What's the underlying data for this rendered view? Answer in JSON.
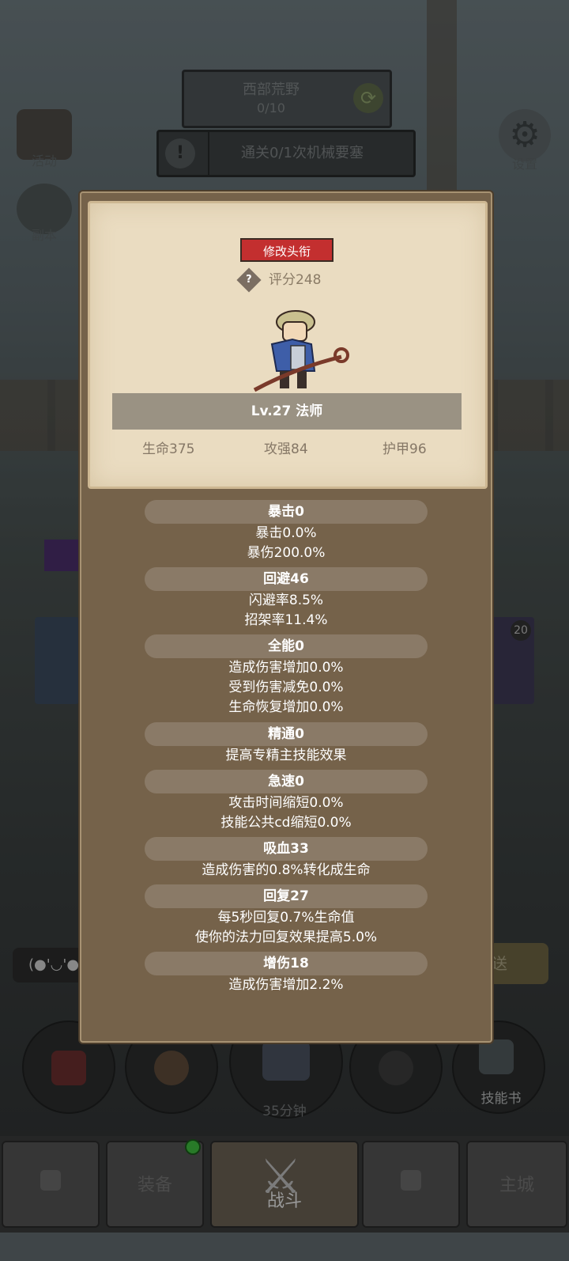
{
  "header": {
    "map_name": "西部荒野",
    "map_progress": "0/10",
    "quest_text": "通关0/1次机械要塞"
  },
  "side": {
    "activity_label": "活动",
    "dungeon_label": "副本",
    "settings_label": "设置"
  },
  "profile": {
    "edit_title_label": "修改头衔",
    "score_label": "评分248",
    "level_class": "Lv.27 法师",
    "hp": "生命375",
    "attack": "攻强84",
    "armor": "护甲96"
  },
  "attributes": [
    {
      "head": "暴击0",
      "lines": [
        "暴击0.0%",
        "暴伤200.0%"
      ]
    },
    {
      "head": "回避46",
      "lines": [
        "闪避率8.5%",
        "招架率11.4%"
      ]
    },
    {
      "head": "全能0",
      "lines": [
        "造成伤害增加0.0%",
        "受到伤害减免0.0%",
        "生命恢复增加0.0%"
      ]
    },
    {
      "head": "精通0",
      "lines": [
        "提高专精主技能效果"
      ]
    },
    {
      "head": "急速0",
      "lines": [
        "攻击时间缩短0.0%",
        "技能公共cd缩短0.0%"
      ]
    },
    {
      "head": "吸血33",
      "lines": [
        "造成伤害的0.8%转化成生命"
      ]
    },
    {
      "head": "回复27",
      "lines": [
        "每5秒回复0.7%生命值",
        "使你的法力回复效果提高5.0%"
      ]
    },
    {
      "head": "增伤18",
      "lines": [
        "造成伤害增加2.2%"
      ]
    }
  ],
  "background_texts": {
    "chat_emote": "(●'◡'●",
    "send_partial": "送",
    "badge_count": "20"
  },
  "bottom": {
    "skill_book_label": "技能书",
    "timer_label": "35分钟"
  },
  "nav": {
    "equip_label": "装备",
    "battle_label": "战斗",
    "city_label": "主城"
  },
  "colors": {
    "title_button": "#c32f2f",
    "panel": "#75624a",
    "card": "#eadcc1",
    "attr_head": "#8a7a67",
    "notify_dot": "#3ebc3e"
  }
}
